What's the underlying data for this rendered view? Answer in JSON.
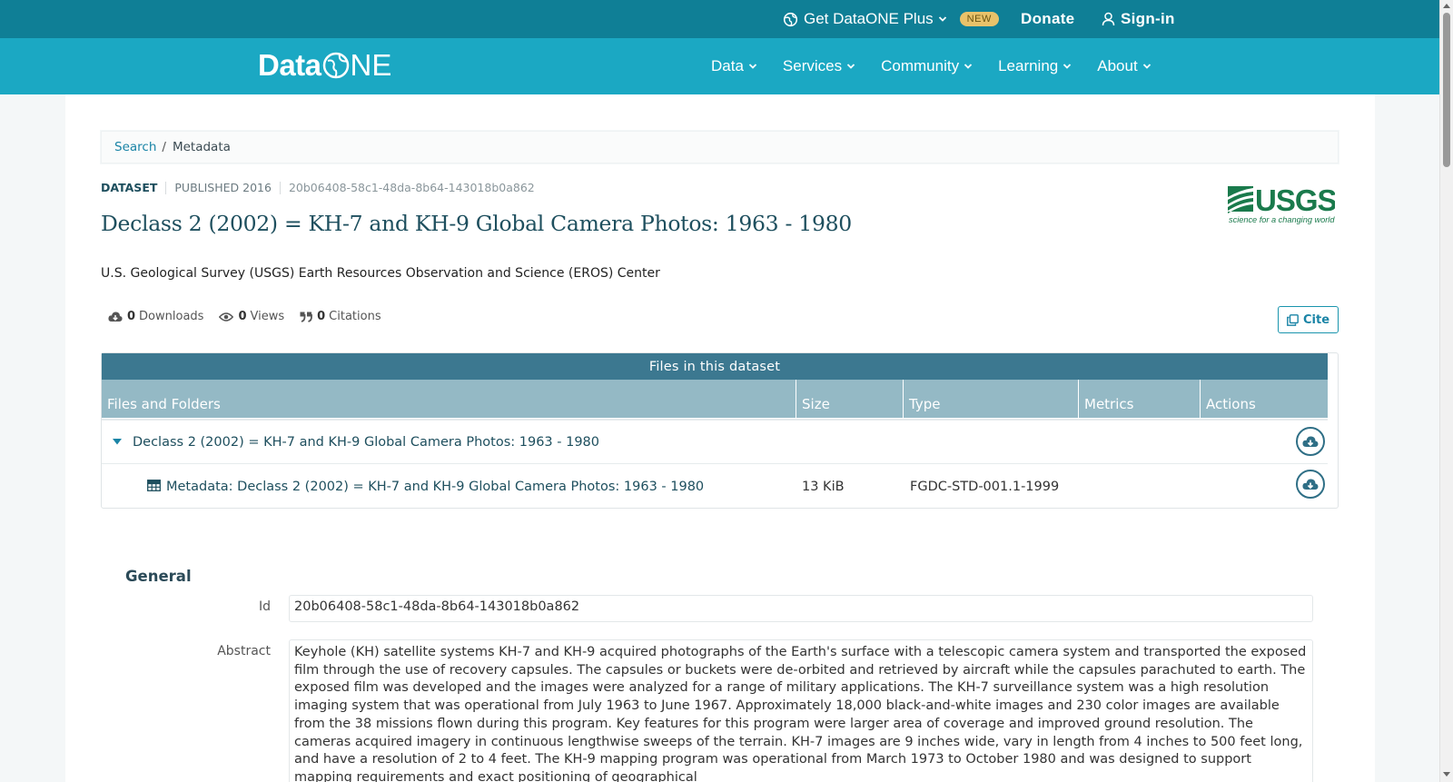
{
  "topbar": {
    "plus_label": "Get DataONE Plus",
    "new_badge": "NEW",
    "donate_label": "Donate",
    "signin_label": "Sign-in"
  },
  "logo": {
    "data": "Data",
    "one": "NE"
  },
  "nav": {
    "items": [
      {
        "label": "Data"
      },
      {
        "label": "Services"
      },
      {
        "label": "Community"
      },
      {
        "label": "Learning"
      },
      {
        "label": "About"
      }
    ]
  },
  "breadcrumb": {
    "search": "Search",
    "sep": "/",
    "current": "Metadata"
  },
  "dataset": {
    "type_label": "DATASET",
    "published": "PUBLISHED 2016",
    "identifier": "20b06408-58c1-48da-8b64-143018b0a862",
    "title": "Declass 2 (2002) = KH-7 and KH-9 Global Camera Photos: 1963 - 1980",
    "organization": "U.S. Geological Survey (USGS) Earth Resources Observation and Science (EROS) Center",
    "logo_text": "USGS",
    "logo_tagline": "science for a changing world"
  },
  "metrics": {
    "downloads_count": "0",
    "downloads_label": "Downloads",
    "views_count": "0",
    "views_label": "Views",
    "citations_count": "0",
    "citations_label": "Citations"
  },
  "cite_label": "Cite",
  "files": {
    "caption": "Files in this dataset",
    "headers": [
      "Files and Folders",
      "Size",
      "Type",
      "Metrics",
      "Actions"
    ],
    "package": {
      "name": "Declass 2 (2002) = KH-7 and KH-9 Global Camera Photos: 1963 - 1980"
    },
    "rows": [
      {
        "name": "Metadata: Declass 2 (2002) = KH-7 and KH-9 Global Camera Photos: 1963 - 1980",
        "size": "13 KiB",
        "type": "FGDC-STD-001.1-1999"
      }
    ]
  },
  "general": {
    "title": "General",
    "id_label": "Id",
    "id_value": "20b06408-58c1-48da-8b64-143018b0a862",
    "abstract_label": "Abstract",
    "abstract_value": "Keyhole (KH) satellite systems KH-7 and KH-9 acquired photographs of the Earth's surface with a telescopic camera system and transported the exposed film through the use of recovery capsules. The capsules or buckets were de-orbited and retrieved by aircraft while the capsules parachuted to earth. The exposed film was developed and the images were analyzed for a range of military applications. The KH-7 surveillance system was a high resolution imaging system that was operational from July 1963 to June 1967. Approximately 18,000 black-and-white images and 230 color images are available from the 38 missions flown during this program. Key features for this program were larger area of coverage and improved ground resolution. The cameras acquired imagery in continuous lengthwise sweeps of the terrain. KH-7 images are 9 inches wide, vary in length from 4 inches to 500 feet long, and have a resolution of 2 to 4 feet. The KH-9 mapping program was operational from March 1973 to October 1980 and was designed to support mapping requirements and exact positioning of geographical"
  },
  "colors": {
    "topbar": "#0f7f96",
    "navbar": "#1ba8c3",
    "table_caption": "#3c7890",
    "table_header": "#94b9c5",
    "title": "#1e4f5e",
    "link": "#1a84a6",
    "usgs_green": "#1a7a4c"
  }
}
